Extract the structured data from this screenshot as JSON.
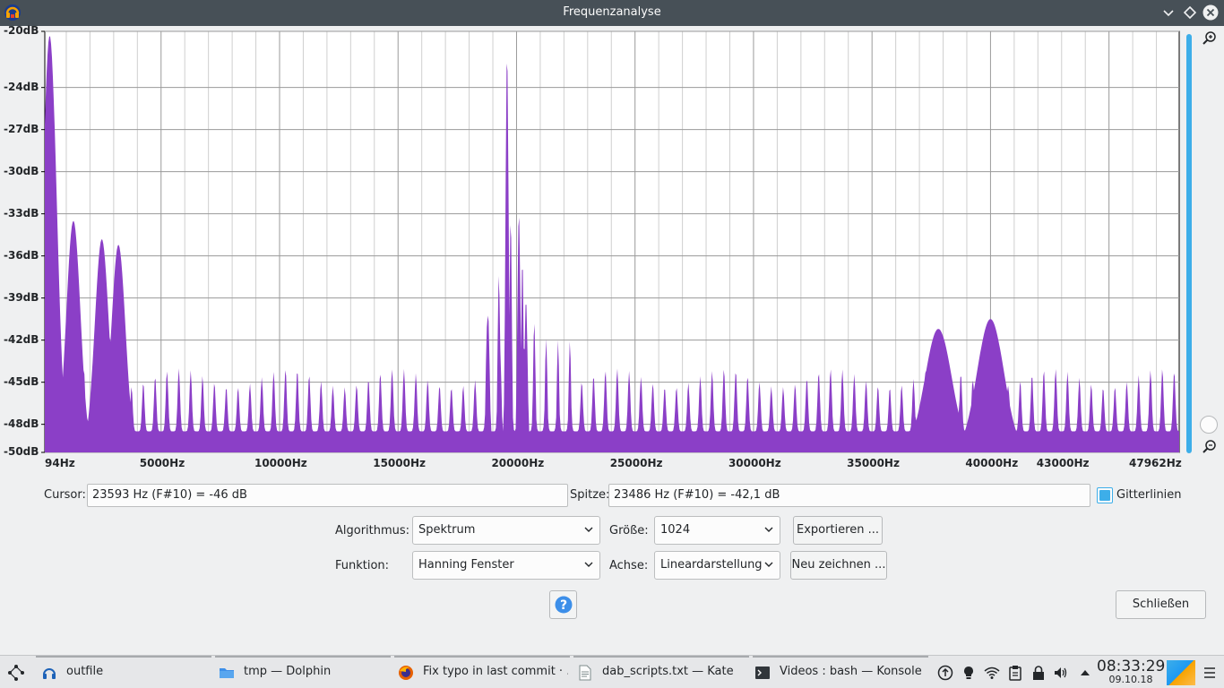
{
  "window": {
    "title": "Frequenzanalyse"
  },
  "chart_data": {
    "type": "area",
    "title": "",
    "xlabel": "",
    "ylabel": "",
    "ylim": [
      -50,
      -20
    ],
    "xlim": [
      94,
      47962
    ],
    "x_ticks": [
      94,
      5000,
      10000,
      15000,
      20000,
      25000,
      30000,
      35000,
      40000,
      43000,
      47962
    ],
    "x_tick_labels": [
      "94Hz",
      "5000Hz",
      "10000Hz",
      "15000Hz",
      "20000Hz",
      "25000Hz",
      "30000Hz",
      "35000Hz",
      "40000Hz",
      "43000Hz",
      "47962Hz"
    ],
    "y_ticks": [
      -20,
      -24,
      -27,
      -30,
      -33,
      -36,
      -39,
      -42,
      -45,
      -48,
      -50
    ],
    "y_tick_labels": [
      "-20dB",
      "-24dB",
      "-27dB",
      "-30dB",
      "-33dB",
      "-36dB",
      "-39dB",
      "-42dB",
      "-45dB",
      "-48dB",
      "-50dB"
    ],
    "grid": true,
    "fill_color": "#8b3fc7",
    "series": [
      {
        "peaks": [
          {
            "x": 300,
            "y": -20.3
          },
          {
            "x": 1300,
            "y": -33.5
          },
          {
            "x": 2500,
            "y": -34.8
          },
          {
            "x": 3200,
            "y": -35.2
          },
          {
            "x": 18800,
            "y": -40.0
          },
          {
            "x": 19300,
            "y": -42.5
          },
          {
            "x": 19600,
            "y": -21.3
          },
          {
            "x": 20100,
            "y": -32.8
          },
          {
            "x": 20400,
            "y": -39.0
          },
          {
            "x": 37800,
            "y": -41.2
          },
          {
            "x": 40000,
            "y": -40.5
          }
        ],
        "noise_floor": -46.5,
        "comb_spacing_hz": 500
      }
    ]
  },
  "controls": {
    "cursor_label": "Cursor:",
    "cursor_value": "23593 Hz (F#10) = -46 dB",
    "peak_label": "Spitze:",
    "peak_value": "23486 Hz (F#10) = -42,1 dB",
    "grid_label": "Gitterlinien",
    "grid_checked": true,
    "algorithm_label": "Algorithmus:",
    "algorithm_value": "Spektrum",
    "size_label": "Größe:",
    "size_value": "1024",
    "export_label": "Exportieren ...",
    "function_label": "Funktion:",
    "function_value": "Hanning Fenster",
    "axis_label": "Achse:",
    "axis_value": "Lineardarstellung",
    "redraw_label": "Neu zeichnen ...",
    "close_label": "Schließen"
  },
  "taskbar": {
    "tasks": [
      {
        "label": "outfile",
        "icon": "headphones-icon"
      },
      {
        "label": "tmp — Dolphin",
        "icon": "folder-icon"
      },
      {
        "label": "Fix typo in last commit · ...",
        "icon": "firefox-icon"
      },
      {
        "label": "dab_scripts.txt  — Kate",
        "icon": "text-document-icon"
      },
      {
        "label": "Videos : bash — Konsole",
        "icon": "terminal-icon"
      }
    ],
    "time": "08:33:29",
    "date": "09.10.18"
  }
}
